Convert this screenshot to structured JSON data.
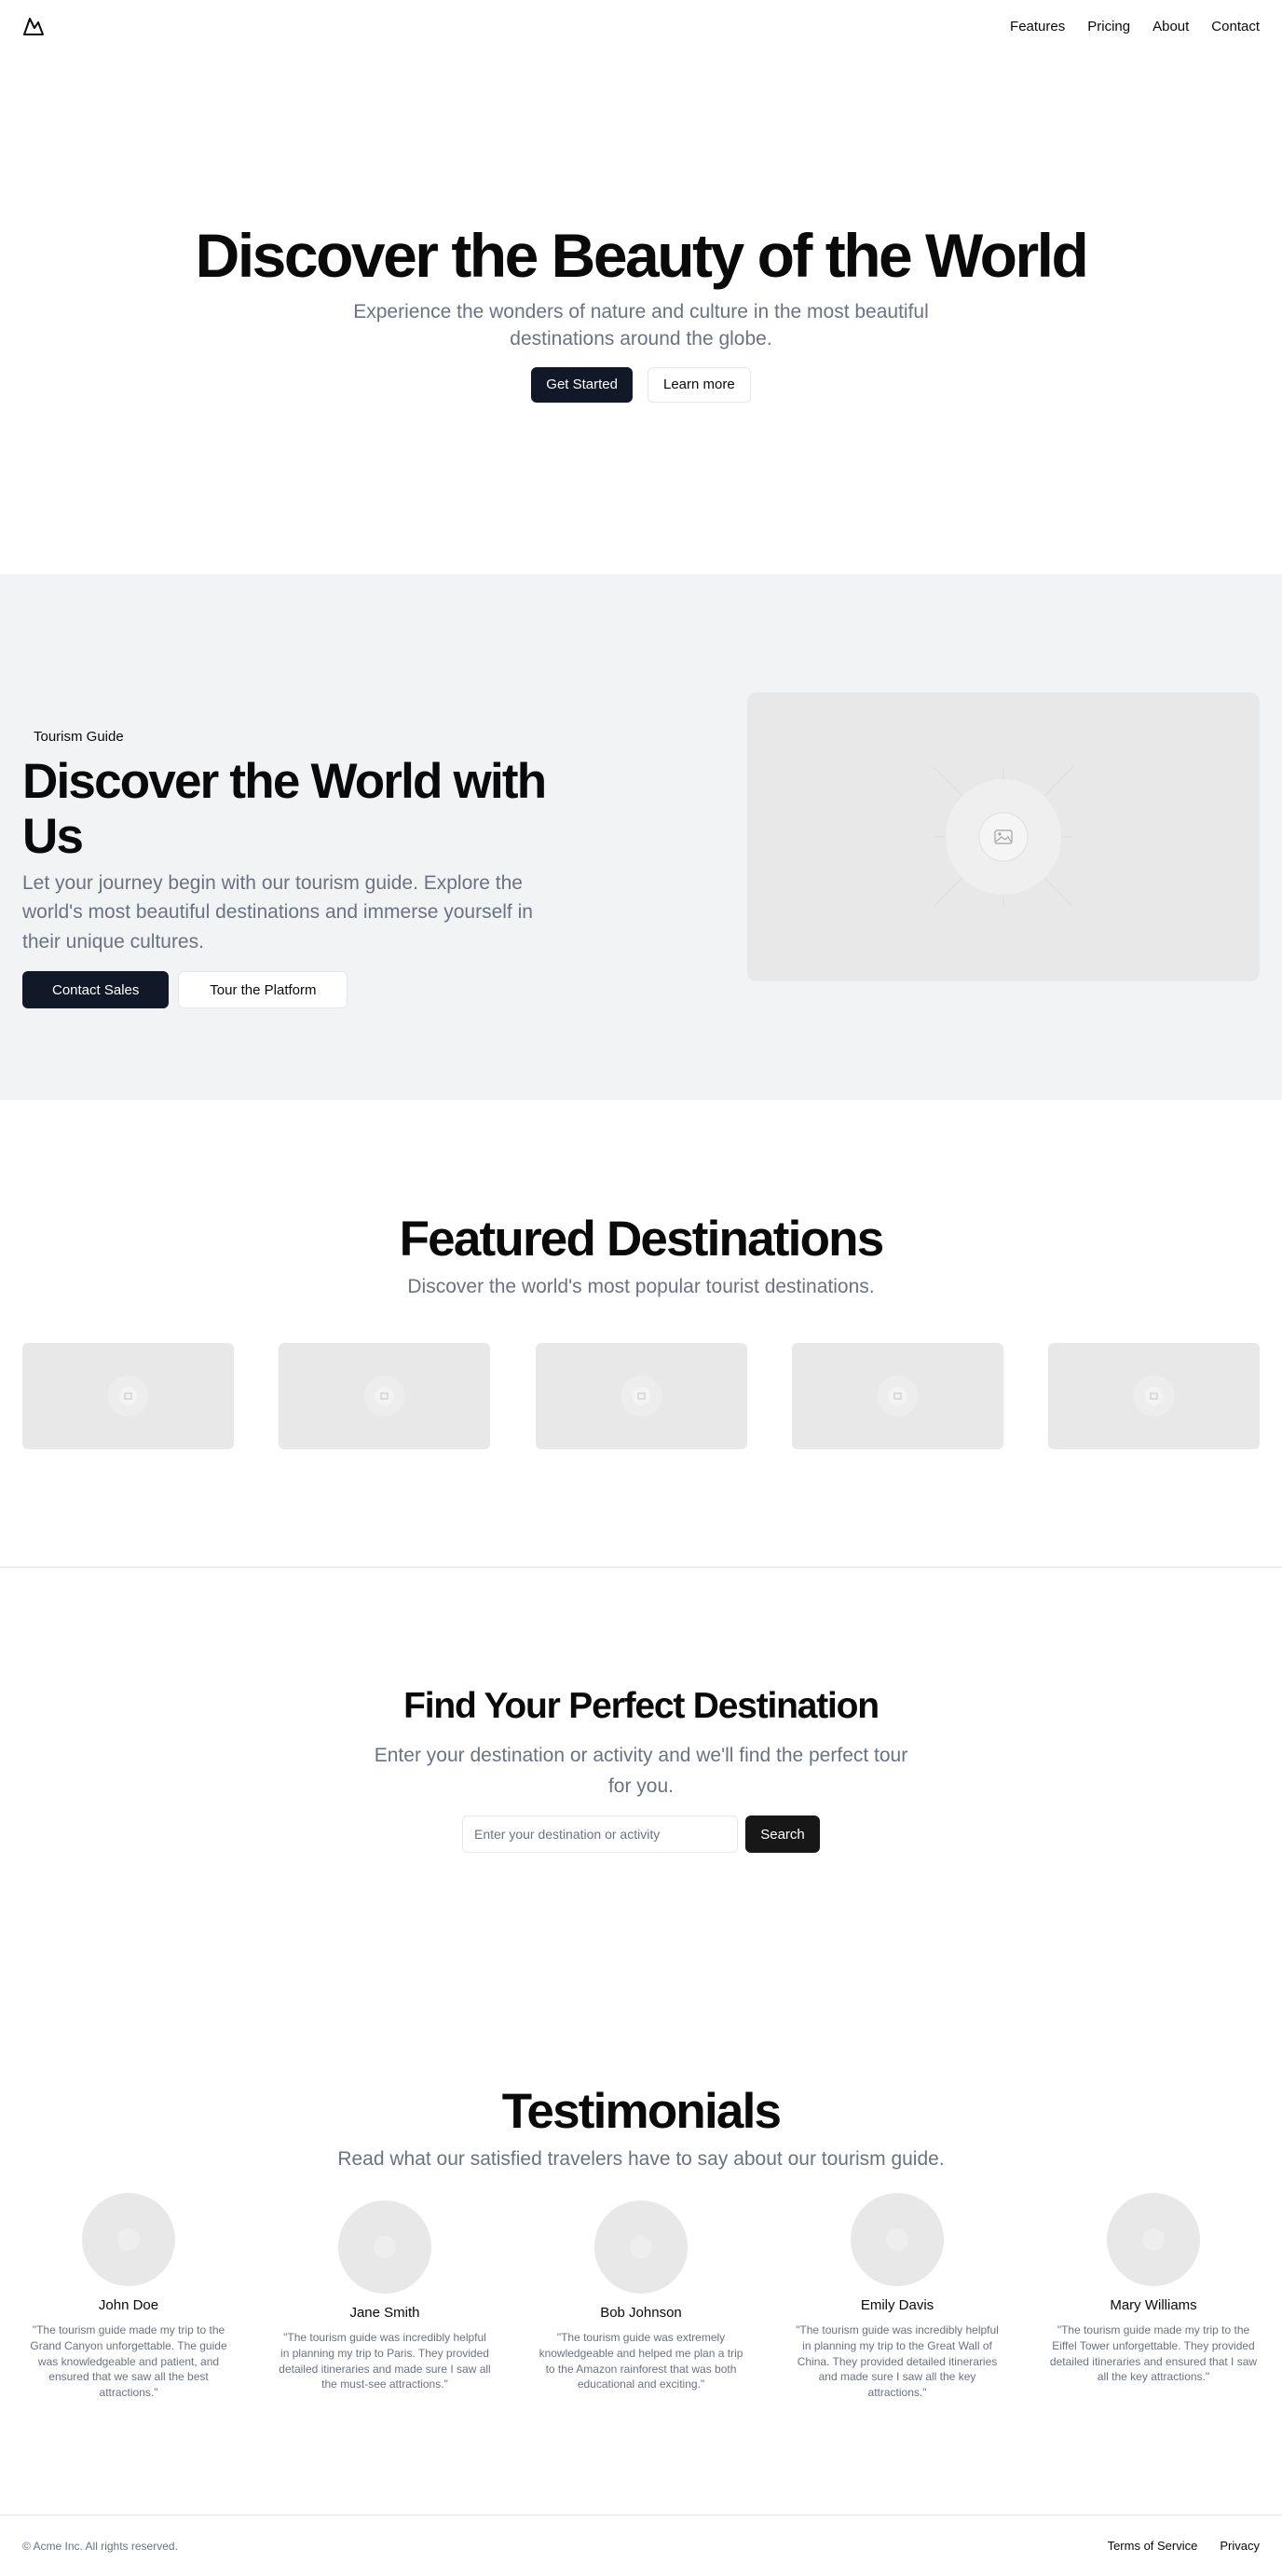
{
  "header": {
    "nav": [
      "Features",
      "Pricing",
      "About",
      "Contact"
    ]
  },
  "hero": {
    "title": "Discover the Beauty of the World",
    "subtitle": "Experience the wonders of nature and culture in the most beautiful destinations around the globe.",
    "primary_button": "Get Started",
    "secondary_button": "Learn more"
  },
  "guide": {
    "badge": "Tourism Guide",
    "title": "Discover the World with Us",
    "description": "Let your journey begin with our tourism guide. Explore the world's most beautiful destinations and immerse yourself in their unique cultures.",
    "primary_button": "Contact Sales",
    "secondary_button": "Tour the Platform",
    "image_icon": "image-placeholder-icon"
  },
  "featured": {
    "title": "Featured Destinations",
    "subtitle": "Discover the world's most popular tourist destinations.",
    "card_count": 5
  },
  "search": {
    "title": "Find Your Perfect Destination",
    "subtitle": "Enter your destination or activity and we'll find the perfect tour for you.",
    "placeholder": "Enter your destination or activity",
    "button": "Search"
  },
  "testimonials": {
    "title": "Testimonials",
    "subtitle": "Read what our satisfied travelers have to say about our tourism guide.",
    "items": [
      {
        "name": "John Doe",
        "quote": "\"The tourism guide made my trip to the Grand Canyon unforgettable. The guide was knowledgeable and patient, and ensured that we saw all the best attractions.\""
      },
      {
        "name": "Jane Smith",
        "quote": "\"The tourism guide was incredibly helpful in planning my trip to Paris. They provided detailed itineraries and made sure I saw all the must-see attractions.\""
      },
      {
        "name": "Bob Johnson",
        "quote": "\"The tourism guide was extremely knowledgeable and helped me plan a trip to the Amazon rainforest that was both educational and exciting.\""
      },
      {
        "name": "Emily Davis",
        "quote": "\"The tourism guide was incredibly helpful in planning my trip to the Great Wall of China. They provided detailed itineraries and made sure I saw all the key attractions.\""
      },
      {
        "name": "Mary Williams",
        "quote": "\"The tourism guide made my trip to the Eiffel Tower unforgettable. They provided detailed itineraries and ensured that I saw all the key attractions.\""
      }
    ]
  },
  "footer": {
    "copyright": "© Acme Inc. All rights reserved.",
    "links": [
      "Terms of Service",
      "Privacy"
    ]
  }
}
